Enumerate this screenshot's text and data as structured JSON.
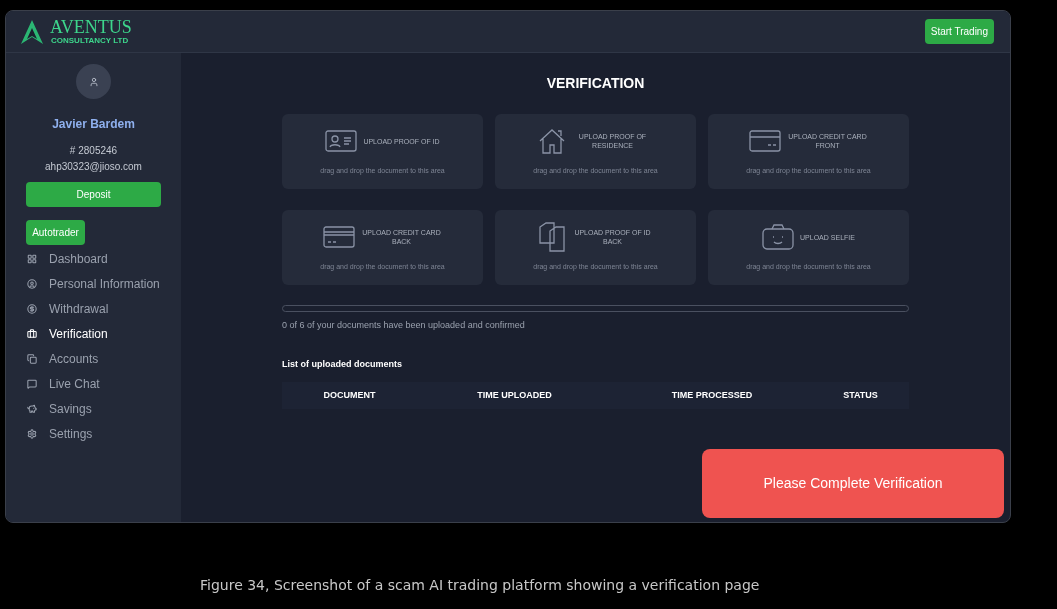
{
  "header": {
    "logo": {
      "name": "AVENTUS",
      "tagline": "CONSULTANCY LTD"
    },
    "start_button": "Start Trading"
  },
  "profile": {
    "name": "Javier Bardem",
    "account_number": "# 2805246",
    "email": "ahp30323@jioso.com"
  },
  "deposit_button": "Deposit",
  "autotrader_button": "Autotrader",
  "sidebar": {
    "items": [
      {
        "kind": "dashboard",
        "label": "Dashboard",
        "selected": false
      },
      {
        "kind": "person",
        "label": "Personal Information",
        "selected": false
      },
      {
        "kind": "dollar",
        "label": "Withdrawal",
        "selected": false
      },
      {
        "kind": "briefcase",
        "label": "Verification",
        "selected": true
      },
      {
        "kind": "copy",
        "label": "Accounts",
        "selected": false
      },
      {
        "kind": "chat",
        "label": "Live Chat",
        "selected": false
      },
      {
        "kind": "piggy",
        "label": "Savings",
        "selected": false
      },
      {
        "kind": "settings",
        "label": "Settings",
        "selected": false
      }
    ]
  },
  "title": "VERIFICATION",
  "uploads": [
    {
      "kind": "id",
      "title": "UPLOAD PROOF OF ID",
      "hint": "drag and drop the document to this area"
    },
    {
      "kind": "house",
      "title": "UPLOAD PROOF OF RESIDENCE",
      "hint": "drag and drop the document to this area"
    },
    {
      "kind": "card_front",
      "title": "UPLOAD CREDIT CARD FRONT",
      "hint": "drag and drop the document to this area"
    },
    {
      "kind": "card_back",
      "title": "UPLOAD CREDIT CARD BACK",
      "hint": "drag and drop the document to this area"
    },
    {
      "kind": "documents",
      "title": "UPLOAD PROOF OF ID BACK",
      "hint": "drag and drop the document to this area"
    },
    {
      "kind": "selfie",
      "title": "UPLOAD SELFIE",
      "hint": "drag and drop the document to this area"
    }
  ],
  "progress": {
    "level": 0,
    "text": "0 of 6 of your documents have been uploaded and confirmed"
  },
  "list_title": "List of uploaded documents",
  "table": {
    "columns": [
      "DOCUMENT",
      "TIME UPLOADED",
      "TIME PROCESSED",
      "STATUS"
    ]
  },
  "toast": "Please Complete Verification",
  "caption": "Figure 34, Screenshot of a scam AI trading platform showing a verification page"
}
